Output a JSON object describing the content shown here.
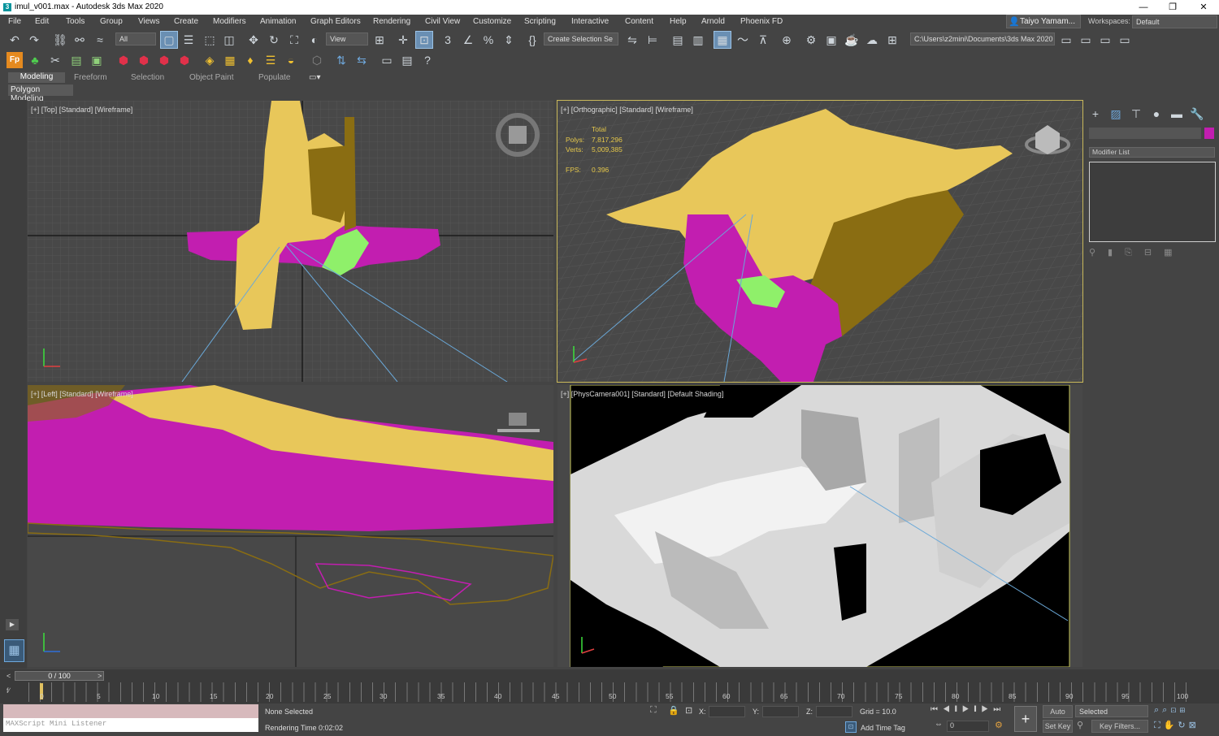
{
  "title_bar": {
    "title": "imul_v001.max - Autodesk 3ds Max 2020",
    "minimize": "—",
    "restore": "❐",
    "close": "✕"
  },
  "menu": [
    "File",
    "Edit",
    "Tools",
    "Group",
    "Views",
    "Create",
    "Modifiers",
    "Animation",
    "Graph Editors",
    "Rendering",
    "Civil View",
    "Customize",
    "Scripting",
    "Interactive",
    "Content",
    "Help",
    "Arnold",
    "Phoenix FD"
  ],
  "user": "Taiyo Yamam...",
  "workspaces": {
    "label": "Workspaces:",
    "value": "Default"
  },
  "toolbar": {
    "selection_filter": "All",
    "ref_coord": "View",
    "named_selection": "Create Selection Se",
    "project_path": "C:\\Users\\z2mini\\Documents\\3ds Max 2020"
  },
  "ribbon": {
    "tabs": [
      "Modeling",
      "Freeform",
      "Selection",
      "Object Paint",
      "Populate"
    ],
    "panel": "Polygon Modeling"
  },
  "viewports": {
    "top": {
      "label": "[+] [Top] [Standard] [Wireframe]"
    },
    "ortho": {
      "label": "[+] [Orthographic] [Standard] [Wireframe]",
      "stats": {
        "total": "Total",
        "polys_label": "Polys:",
        "polys": "7,817,296",
        "verts_label": "Verts:",
        "verts": "5,009,385",
        "fps_label": "FPS:",
        "fps": "0.396"
      }
    },
    "left": {
      "label": "[+] [Left] [Standard] [Wireframe]"
    },
    "camera": {
      "label": "[+] [PhysCamera001] [Standard] [Default Shading]"
    }
  },
  "command_panel": {
    "modifier_list": "Modifier List"
  },
  "timeline": {
    "frame": "0 / 100",
    "ticks": [
      "0",
      "5",
      "10",
      "15",
      "20",
      "25",
      "30",
      "35",
      "40",
      "45",
      "50",
      "55",
      "60",
      "65",
      "70",
      "75",
      "80",
      "85",
      "90",
      "95",
      "100"
    ]
  },
  "status": {
    "listener": "MAXScript Mini Listener",
    "selection": "None Selected",
    "render_time": "Rendering Time  0:02:02",
    "x_label": "X:",
    "y_label": "Y:",
    "z_label": "Z:",
    "grid": "Grid = 10.0",
    "add_time_tag": "Add Time Tag",
    "auto_key": "Auto Key",
    "set_key": "Set Key",
    "key_mode": "Selected",
    "key_filters": "Key Filters...",
    "current_frame": "0"
  },
  "colors": {
    "yellow": "#e8c75a",
    "magenta": "#c21eb0",
    "olive": "#8a6d12",
    "green": "#8ff06a",
    "active_border": "#c9b85a"
  }
}
